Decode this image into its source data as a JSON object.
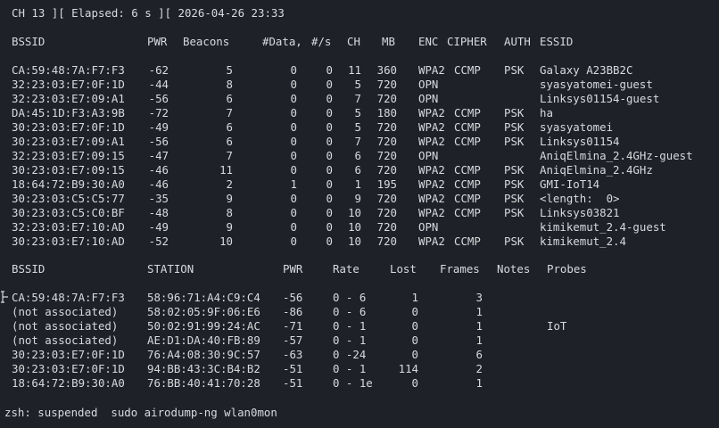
{
  "terminal": {
    "status_line": "CH 13 ][ Elapsed: 6 s ][ 2026-04-26 23:33",
    "prompt_line": "zsh: suspended  sudo airodump-ng wlan0mon"
  },
  "ap_table": {
    "headers": {
      "bssid": "BSSID",
      "pwr": "PWR",
      "beacons": "Beacons",
      "data": "#Data,",
      "rate": "#/s",
      "ch": "CH",
      "mb": "MB",
      "enc": "ENC",
      "cipher": "CIPHER",
      "auth": "AUTH",
      "essid": "ESSID"
    },
    "rows": [
      {
        "bssid": "CA:59:48:7A:F7:F3",
        "pwr": "-62",
        "beacons": "5",
        "data": "0",
        "rate": "0",
        "ch": "11",
        "mb": "360",
        "enc": "WPA2",
        "cipher": "CCMP",
        "auth": "PSK",
        "essid": "Galaxy A23BB2C"
      },
      {
        "bssid": "32:23:03:E7:0F:1D",
        "pwr": "-44",
        "beacons": "8",
        "data": "0",
        "rate": "0",
        "ch": "5",
        "mb": "720",
        "enc": "OPN",
        "cipher": "",
        "auth": "",
        "essid": "syasyatomei-guest"
      },
      {
        "bssid": "32:23:03:E7:09:A1",
        "pwr": "-56",
        "beacons": "6",
        "data": "0",
        "rate": "0",
        "ch": "7",
        "mb": "720",
        "enc": "OPN",
        "cipher": "",
        "auth": "",
        "essid": "Linksys01154-guest"
      },
      {
        "bssid": "DA:45:1D:F3:A3:9B",
        "pwr": "-72",
        "beacons": "7",
        "data": "0",
        "rate": "0",
        "ch": "5",
        "mb": "180",
        "enc": "WPA2",
        "cipher": "CCMP",
        "auth": "PSK",
        "essid": "ha"
      },
      {
        "bssid": "30:23:03:E7:0F:1D",
        "pwr": "-49",
        "beacons": "6",
        "data": "0",
        "rate": "0",
        "ch": "5",
        "mb": "720",
        "enc": "WPA2",
        "cipher": "CCMP",
        "auth": "PSK",
        "essid": "syasyatomei"
      },
      {
        "bssid": "30:23:03:E7:09:A1",
        "pwr": "-56",
        "beacons": "6",
        "data": "0",
        "rate": "0",
        "ch": "7",
        "mb": "720",
        "enc": "WPA2",
        "cipher": "CCMP",
        "auth": "PSK",
        "essid": "Linksys01154"
      },
      {
        "bssid": "32:23:03:E7:09:15",
        "pwr": "-47",
        "beacons": "7",
        "data": "0",
        "rate": "0",
        "ch": "6",
        "mb": "720",
        "enc": "OPN",
        "cipher": "",
        "auth": "",
        "essid": "AniqElmina_2.4GHz-guest"
      },
      {
        "bssid": "30:23:03:E7:09:15",
        "pwr": "-46",
        "beacons": "11",
        "data": "0",
        "rate": "0",
        "ch": "6",
        "mb": "720",
        "enc": "WPA2",
        "cipher": "CCMP",
        "auth": "PSK",
        "essid": "AniqElmina_2.4GHz"
      },
      {
        "bssid": "18:64:72:B9:30:A0",
        "pwr": "-46",
        "beacons": "2",
        "data": "1",
        "rate": "0",
        "ch": "1",
        "mb": "195",
        "enc": "WPA2",
        "cipher": "CCMP",
        "auth": "PSK",
        "essid": "GMI-IoT14"
      },
      {
        "bssid": "30:23:03:C5:C5:77",
        "pwr": "-35",
        "beacons": "9",
        "data": "0",
        "rate": "0",
        "ch": "9",
        "mb": "720",
        "enc": "WPA2",
        "cipher": "CCMP",
        "auth": "PSK",
        "essid": "<length:  0>"
      },
      {
        "bssid": "30:23:03:C5:C0:BF",
        "pwr": "-48",
        "beacons": "8",
        "data": "0",
        "rate": "0",
        "ch": "10",
        "mb": "720",
        "enc": "WPA2",
        "cipher": "CCMP",
        "auth": "PSK",
        "essid": "Linksys03821"
      },
      {
        "bssid": "32:23:03:E7:10:AD",
        "pwr": "-49",
        "beacons": "9",
        "data": "0",
        "rate": "0",
        "ch": "10",
        "mb": "720",
        "enc": "OPN",
        "cipher": "",
        "auth": "",
        "essid": "kimikemut_2.4-guest"
      },
      {
        "bssid": "30:23:03:E7:10:AD",
        "pwr": "-52",
        "beacons": "10",
        "data": "0",
        "rate": "0",
        "ch": "10",
        "mb": "720",
        "enc": "WPA2",
        "cipher": "CCMP",
        "auth": "PSK",
        "essid": "kimikemut_2.4"
      }
    ]
  },
  "station_table": {
    "headers": {
      "bssid": "BSSID",
      "station": "STATION",
      "pwr": "PWR",
      "rate": "Rate",
      "lost": "Lost",
      "frames": "Frames",
      "notes": "Notes",
      "probes": "Probes"
    },
    "rows": [
      {
        "bssid": "CA:59:48:7A:F7:F3",
        "station": "58:96:71:A4:C9:C4",
        "pwr": "-56",
        "rate": "0 - 6",
        "lost": "1",
        "frames": "3",
        "notes": "",
        "probes": ""
      },
      {
        "bssid": "(not associated)",
        "station": "58:02:05:9F:06:E6",
        "pwr": "-86",
        "rate": "0 - 6",
        "lost": "0",
        "frames": "1",
        "notes": "",
        "probes": ""
      },
      {
        "bssid": "(not associated)",
        "station": "50:02:91:99:24:AC",
        "pwr": "-71",
        "rate": "0 - 1",
        "lost": "0",
        "frames": "1",
        "notes": "",
        "probes": "IoT"
      },
      {
        "bssid": "(not associated)",
        "station": "AE:D1:DA:40:FB:89",
        "pwr": "-57",
        "rate": "0 - 1",
        "lost": "0",
        "frames": "1",
        "notes": "",
        "probes": ""
      },
      {
        "bssid": "30:23:03:E7:0F:1D",
        "station": "76:A4:08:30:9C:57",
        "pwr": "-63",
        "rate": "0 -24",
        "lost": "0",
        "frames": "6",
        "notes": "",
        "probes": ""
      },
      {
        "bssid": "30:23:03:E7:0F:1D",
        "station": "94:BB:43:3C:B4:B2",
        "pwr": "-51",
        "rate": "0 - 1",
        "lost": "114",
        "frames": "2",
        "notes": "",
        "probes": ""
      },
      {
        "bssid": "18:64:72:B9:30:A0",
        "station": "76:BB:40:41:70:28",
        "pwr": "-51",
        "rate": "0 - 1e",
        "lost": "0",
        "frames": "1",
        "notes": "",
        "probes": ""
      }
    ]
  },
  "colors": {
    "background": "#1e2127",
    "foreground": "#d8dade"
  }
}
